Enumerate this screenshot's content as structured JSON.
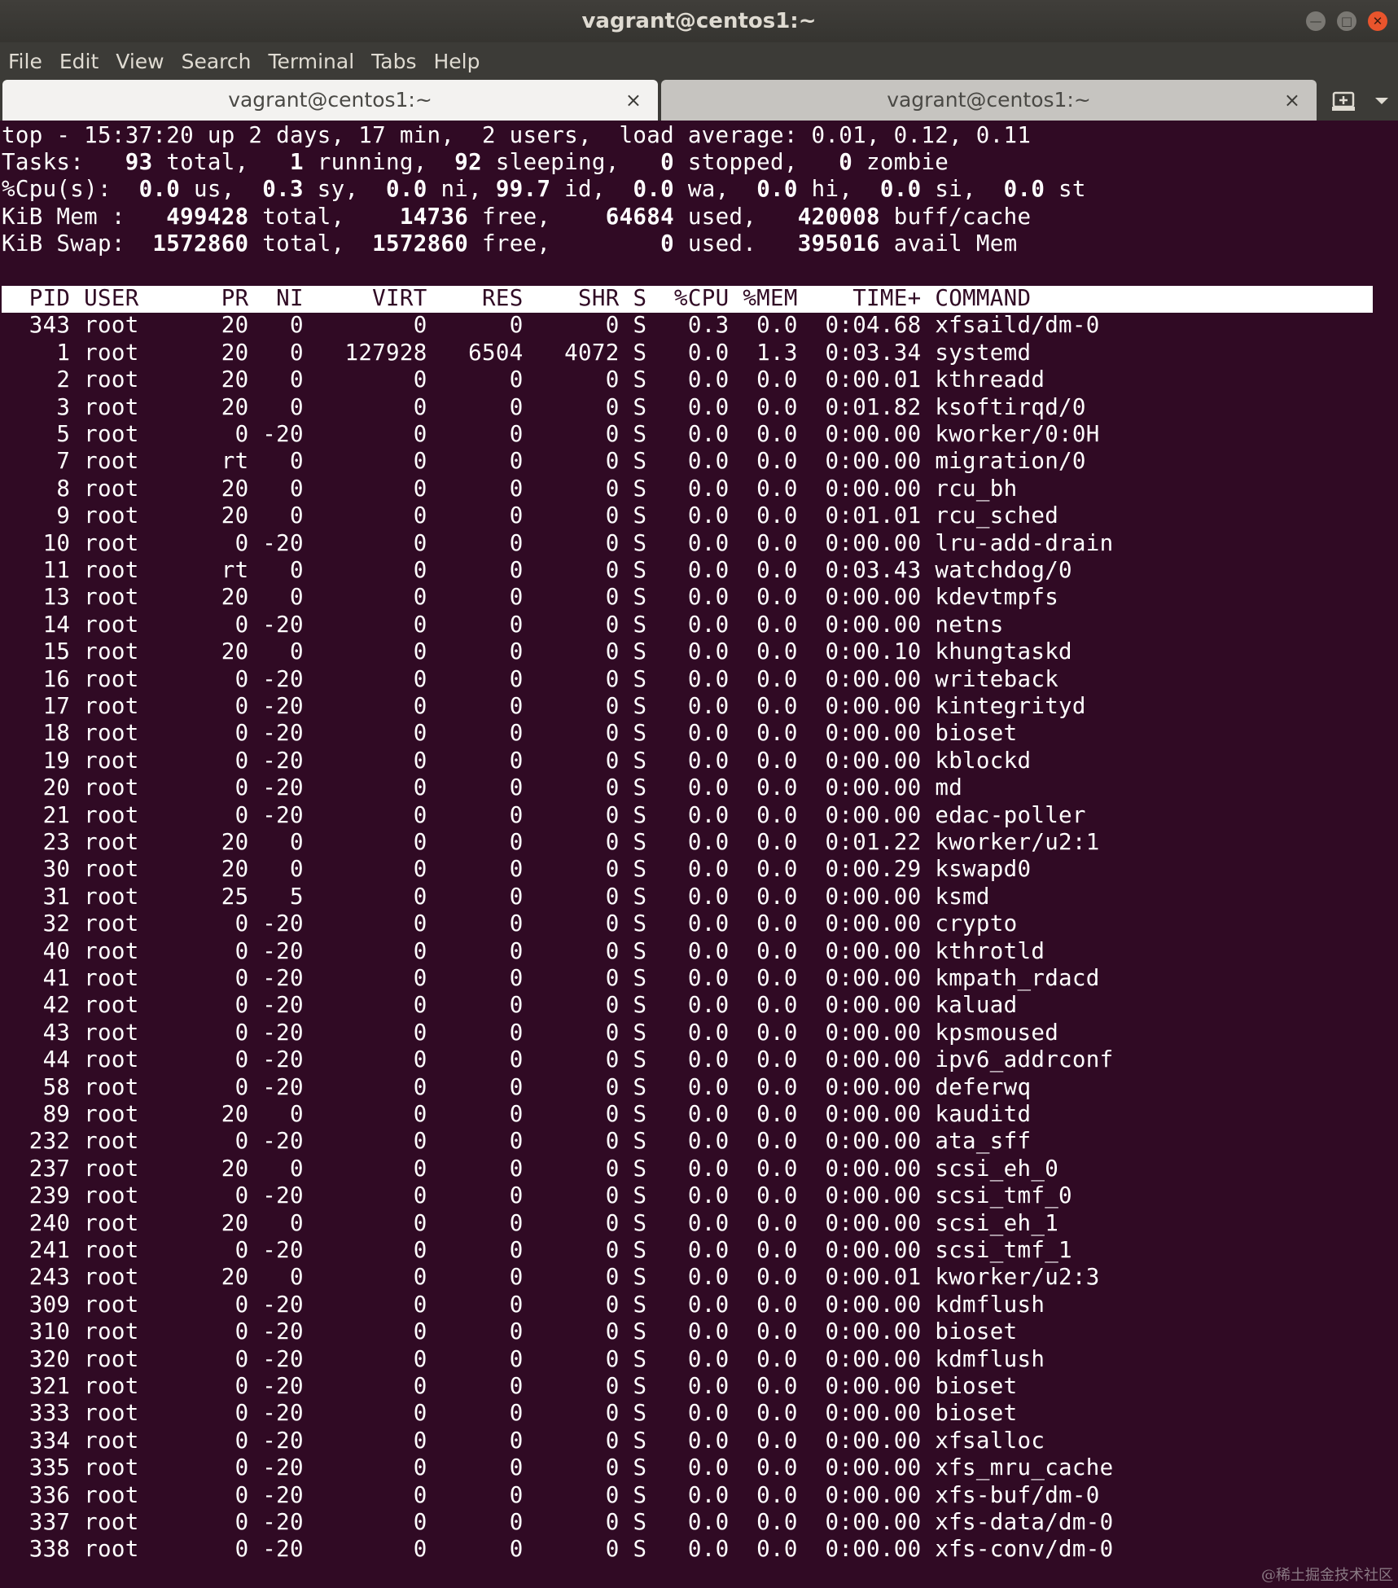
{
  "window": {
    "title": "vagrant@centos1:~",
    "controls": {
      "minimize": "—",
      "maximize": "□",
      "close": "✕"
    }
  },
  "menu": [
    "File",
    "Edit",
    "View",
    "Search",
    "Terminal",
    "Tabs",
    "Help"
  ],
  "tabs": [
    {
      "label": "vagrant@centos1:~",
      "close": "×",
      "active": true
    },
    {
      "label": "vagrant@centos1:~",
      "close": "×",
      "active": false
    }
  ],
  "icons": {
    "new_tab": "new-tab-icon",
    "tabs_menu": "chevron-down-icon"
  },
  "colors": {
    "terminal_bg": "#300a24",
    "text": "#ffffff",
    "titlebar": "#3c3b37",
    "close_button": "#e9542c"
  },
  "top_summary": [
    [
      {
        "t": "top - 15:37:20 up 2 days, 17 min,  2 users,  load average: 0.01, 0.12, 0.11"
      }
    ],
    [
      {
        "t": "Tasks: "
      },
      {
        "t": "  93",
        "b": true
      },
      {
        "t": " total,   "
      },
      {
        "t": "1",
        "b": true
      },
      {
        "t": " running,  "
      },
      {
        "t": "92",
        "b": true
      },
      {
        "t": " sleeping,   "
      },
      {
        "t": "0",
        "b": true
      },
      {
        "t": " stopped,   "
      },
      {
        "t": "0",
        "b": true
      },
      {
        "t": " zombie"
      }
    ],
    [
      {
        "t": "%Cpu(s):  "
      },
      {
        "t": "0.0",
        "b": true
      },
      {
        "t": " us,  "
      },
      {
        "t": "0.3",
        "b": true
      },
      {
        "t": " sy,  "
      },
      {
        "t": "0.0",
        "b": true
      },
      {
        "t": " ni, "
      },
      {
        "t": "99.7",
        "b": true
      },
      {
        "t": " id,  "
      },
      {
        "t": "0.0",
        "b": true
      },
      {
        "t": " wa,  "
      },
      {
        "t": "0.0",
        "b": true
      },
      {
        "t": " hi,  "
      },
      {
        "t": "0.0",
        "b": true
      },
      {
        "t": " si,  "
      },
      {
        "t": "0.0",
        "b": true
      },
      {
        "t": " st"
      }
    ],
    [
      {
        "t": "KiB Mem :   "
      },
      {
        "t": "499428",
        "b": true
      },
      {
        "t": " total,    "
      },
      {
        "t": "14736",
        "b": true
      },
      {
        "t": " free,    "
      },
      {
        "t": "64684",
        "b": true
      },
      {
        "t": " used,   "
      },
      {
        "t": "420008",
        "b": true
      },
      {
        "t": " buff/cache"
      }
    ],
    [
      {
        "t": "KiB Swap:  "
      },
      {
        "t": "1572860",
        "b": true
      },
      {
        "t": " total,  "
      },
      {
        "t": "1572860",
        "b": true
      },
      {
        "t": " free,        "
      },
      {
        "t": "0",
        "b": true
      },
      {
        "t": " used.   "
      },
      {
        "t": "395016",
        "b": true
      },
      {
        "t": " avail Mem"
      }
    ]
  ],
  "columns": [
    "PID",
    "USER",
    "PR",
    "NI",
    "VIRT",
    "RES",
    "SHR",
    "S",
    "%CPU",
    "%MEM",
    "TIME+",
    "COMMAND"
  ],
  "processes": [
    [
      "343",
      "root",
      "20",
      "0",
      "0",
      "0",
      "0",
      "S",
      "0.3",
      "0.0",
      "0:04.68",
      "xfsaild/dm-0"
    ],
    [
      "1",
      "root",
      "20",
      "0",
      "127928",
      "6504",
      "4072",
      "S",
      "0.0",
      "1.3",
      "0:03.34",
      "systemd"
    ],
    [
      "2",
      "root",
      "20",
      "0",
      "0",
      "0",
      "0",
      "S",
      "0.0",
      "0.0",
      "0:00.01",
      "kthreadd"
    ],
    [
      "3",
      "root",
      "20",
      "0",
      "0",
      "0",
      "0",
      "S",
      "0.0",
      "0.0",
      "0:01.82",
      "ksoftirqd/0"
    ],
    [
      "5",
      "root",
      "0",
      "-20",
      "0",
      "0",
      "0",
      "S",
      "0.0",
      "0.0",
      "0:00.00",
      "kworker/0:0H"
    ],
    [
      "7",
      "root",
      "rt",
      "0",
      "0",
      "0",
      "0",
      "S",
      "0.0",
      "0.0",
      "0:00.00",
      "migration/0"
    ],
    [
      "8",
      "root",
      "20",
      "0",
      "0",
      "0",
      "0",
      "S",
      "0.0",
      "0.0",
      "0:00.00",
      "rcu_bh"
    ],
    [
      "9",
      "root",
      "20",
      "0",
      "0",
      "0",
      "0",
      "S",
      "0.0",
      "0.0",
      "0:01.01",
      "rcu_sched"
    ],
    [
      "10",
      "root",
      "0",
      "-20",
      "0",
      "0",
      "0",
      "S",
      "0.0",
      "0.0",
      "0:00.00",
      "lru-add-drain"
    ],
    [
      "11",
      "root",
      "rt",
      "0",
      "0",
      "0",
      "0",
      "S",
      "0.0",
      "0.0",
      "0:03.43",
      "watchdog/0"
    ],
    [
      "13",
      "root",
      "20",
      "0",
      "0",
      "0",
      "0",
      "S",
      "0.0",
      "0.0",
      "0:00.00",
      "kdevtmpfs"
    ],
    [
      "14",
      "root",
      "0",
      "-20",
      "0",
      "0",
      "0",
      "S",
      "0.0",
      "0.0",
      "0:00.00",
      "netns"
    ],
    [
      "15",
      "root",
      "20",
      "0",
      "0",
      "0",
      "0",
      "S",
      "0.0",
      "0.0",
      "0:00.10",
      "khungtaskd"
    ],
    [
      "16",
      "root",
      "0",
      "-20",
      "0",
      "0",
      "0",
      "S",
      "0.0",
      "0.0",
      "0:00.00",
      "writeback"
    ],
    [
      "17",
      "root",
      "0",
      "-20",
      "0",
      "0",
      "0",
      "S",
      "0.0",
      "0.0",
      "0:00.00",
      "kintegrityd"
    ],
    [
      "18",
      "root",
      "0",
      "-20",
      "0",
      "0",
      "0",
      "S",
      "0.0",
      "0.0",
      "0:00.00",
      "bioset"
    ],
    [
      "19",
      "root",
      "0",
      "-20",
      "0",
      "0",
      "0",
      "S",
      "0.0",
      "0.0",
      "0:00.00",
      "kblockd"
    ],
    [
      "20",
      "root",
      "0",
      "-20",
      "0",
      "0",
      "0",
      "S",
      "0.0",
      "0.0",
      "0:00.00",
      "md"
    ],
    [
      "21",
      "root",
      "0",
      "-20",
      "0",
      "0",
      "0",
      "S",
      "0.0",
      "0.0",
      "0:00.00",
      "edac-poller"
    ],
    [
      "23",
      "root",
      "20",
      "0",
      "0",
      "0",
      "0",
      "S",
      "0.0",
      "0.0",
      "0:01.22",
      "kworker/u2:1"
    ],
    [
      "30",
      "root",
      "20",
      "0",
      "0",
      "0",
      "0",
      "S",
      "0.0",
      "0.0",
      "0:00.29",
      "kswapd0"
    ],
    [
      "31",
      "root",
      "25",
      "5",
      "0",
      "0",
      "0",
      "S",
      "0.0",
      "0.0",
      "0:00.00",
      "ksmd"
    ],
    [
      "32",
      "root",
      "0",
      "-20",
      "0",
      "0",
      "0",
      "S",
      "0.0",
      "0.0",
      "0:00.00",
      "crypto"
    ],
    [
      "40",
      "root",
      "0",
      "-20",
      "0",
      "0",
      "0",
      "S",
      "0.0",
      "0.0",
      "0:00.00",
      "kthrotld"
    ],
    [
      "41",
      "root",
      "0",
      "-20",
      "0",
      "0",
      "0",
      "S",
      "0.0",
      "0.0",
      "0:00.00",
      "kmpath_rdacd"
    ],
    [
      "42",
      "root",
      "0",
      "-20",
      "0",
      "0",
      "0",
      "S",
      "0.0",
      "0.0",
      "0:00.00",
      "kaluad"
    ],
    [
      "43",
      "root",
      "0",
      "-20",
      "0",
      "0",
      "0",
      "S",
      "0.0",
      "0.0",
      "0:00.00",
      "kpsmoused"
    ],
    [
      "44",
      "root",
      "0",
      "-20",
      "0",
      "0",
      "0",
      "S",
      "0.0",
      "0.0",
      "0:00.00",
      "ipv6_addrconf"
    ],
    [
      "58",
      "root",
      "0",
      "-20",
      "0",
      "0",
      "0",
      "S",
      "0.0",
      "0.0",
      "0:00.00",
      "deferwq"
    ],
    [
      "89",
      "root",
      "20",
      "0",
      "0",
      "0",
      "0",
      "S",
      "0.0",
      "0.0",
      "0:00.00",
      "kauditd"
    ],
    [
      "232",
      "root",
      "0",
      "-20",
      "0",
      "0",
      "0",
      "S",
      "0.0",
      "0.0",
      "0:00.00",
      "ata_sff"
    ],
    [
      "237",
      "root",
      "20",
      "0",
      "0",
      "0",
      "0",
      "S",
      "0.0",
      "0.0",
      "0:00.00",
      "scsi_eh_0"
    ],
    [
      "239",
      "root",
      "0",
      "-20",
      "0",
      "0",
      "0",
      "S",
      "0.0",
      "0.0",
      "0:00.00",
      "scsi_tmf_0"
    ],
    [
      "240",
      "root",
      "20",
      "0",
      "0",
      "0",
      "0",
      "S",
      "0.0",
      "0.0",
      "0:00.00",
      "scsi_eh_1"
    ],
    [
      "241",
      "root",
      "0",
      "-20",
      "0",
      "0",
      "0",
      "S",
      "0.0",
      "0.0",
      "0:00.00",
      "scsi_tmf_1"
    ],
    [
      "243",
      "root",
      "20",
      "0",
      "0",
      "0",
      "0",
      "S",
      "0.0",
      "0.0",
      "0:00.01",
      "kworker/u2:3"
    ],
    [
      "309",
      "root",
      "0",
      "-20",
      "0",
      "0",
      "0",
      "S",
      "0.0",
      "0.0",
      "0:00.00",
      "kdmflush"
    ],
    [
      "310",
      "root",
      "0",
      "-20",
      "0",
      "0",
      "0",
      "S",
      "0.0",
      "0.0",
      "0:00.00",
      "bioset"
    ],
    [
      "320",
      "root",
      "0",
      "-20",
      "0",
      "0",
      "0",
      "S",
      "0.0",
      "0.0",
      "0:00.00",
      "kdmflush"
    ],
    [
      "321",
      "root",
      "0",
      "-20",
      "0",
      "0",
      "0",
      "S",
      "0.0",
      "0.0",
      "0:00.00",
      "bioset"
    ],
    [
      "333",
      "root",
      "0",
      "-20",
      "0",
      "0",
      "0",
      "S",
      "0.0",
      "0.0",
      "0:00.00",
      "bioset"
    ],
    [
      "334",
      "root",
      "0",
      "-20",
      "0",
      "0",
      "0",
      "S",
      "0.0",
      "0.0",
      "0:00.00",
      "xfsalloc"
    ],
    [
      "335",
      "root",
      "0",
      "-20",
      "0",
      "0",
      "0",
      "S",
      "0.0",
      "0.0",
      "0:00.00",
      "xfs_mru_cache"
    ],
    [
      "336",
      "root",
      "0",
      "-20",
      "0",
      "0",
      "0",
      "S",
      "0.0",
      "0.0",
      "0:00.00",
      "xfs-buf/dm-0"
    ],
    [
      "337",
      "root",
      "0",
      "-20",
      "0",
      "0",
      "0",
      "S",
      "0.0",
      "0.0",
      "0:00.00",
      "xfs-data/dm-0"
    ],
    [
      "338",
      "root",
      "0",
      "-20",
      "0",
      "0",
      "0",
      "S",
      "0.0",
      "0.0",
      "0:00.00",
      "xfs-conv/dm-0"
    ]
  ],
  "watermark": "@稀土掘金技术社区"
}
